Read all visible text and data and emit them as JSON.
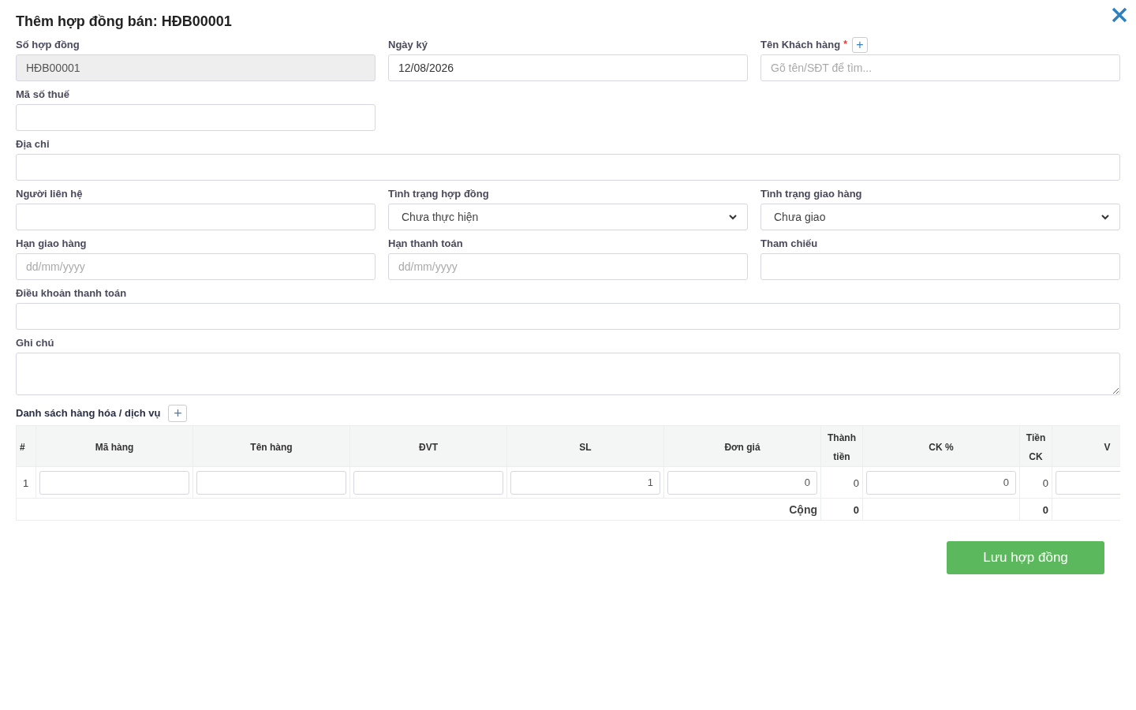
{
  "dialog": {
    "title": "Thêm hợp đồng bán: HĐB00001"
  },
  "fields": [
    {
      "label": "Số hợp đồng",
      "kind": "text",
      "value": "HĐB00001",
      "disabled": true
    },
    {
      "label": "Ngày ký",
      "kind": "text",
      "value": "12/08/2026"
    },
    {
      "label": "Tên Khách hàng",
      "kind": "text",
      "placeholder": "Gõ tên/SĐT để tìm...",
      "required_mark": "*",
      "add_button": "+"
    },
    {
      "label": "Mã số thuế",
      "kind": "text"
    },
    {
      "label": "Địa chỉ",
      "kind": "text",
      "full": true
    },
    {
      "label": "Người liên hệ",
      "kind": "text"
    },
    {
      "label": "Tình trạng hợp đồng",
      "kind": "select",
      "value": "Chưa thực hiện"
    },
    {
      "label": "Tình trạng giao hàng",
      "kind": "select",
      "value": "Chưa giao"
    },
    {
      "label": "Hạn giao hàng",
      "kind": "text",
      "placeholder": "dd/mm/yyyy"
    },
    {
      "label": "Hạn thanh toán",
      "kind": "text",
      "placeholder": "dd/mm/yyyy"
    },
    {
      "label": "Tham chiếu",
      "kind": "text"
    },
    {
      "label": "Điều khoản thanh toán",
      "kind": "text",
      "full": true
    },
    {
      "label": "Ghi chú",
      "kind": "textarea",
      "full": true
    }
  ],
  "items": {
    "title": "Danh sách hàng hóa / dịch vụ",
    "add_button": "+",
    "columns": [
      "#",
      "Mã hàng",
      "Tên hàng",
      "ĐVT",
      "SL",
      "Đơn giá",
      "Thành tiền",
      "CK %",
      "Tiền CK",
      "V"
    ],
    "rows": [
      {
        "cells": [
          {
            "kind": "text",
            "value": "1"
          },
          {
            "kind": "input"
          },
          {
            "kind": "input"
          },
          {
            "kind": "input"
          },
          {
            "kind": "input",
            "value": "1"
          },
          {
            "kind": "input",
            "value": "0"
          },
          {
            "kind": "text",
            "value": "0"
          },
          {
            "kind": "input",
            "value": "0"
          },
          {
            "kind": "text",
            "value": "0"
          },
          {
            "kind": "input"
          }
        ]
      }
    ],
    "footer": {
      "label": "Cộng",
      "total": "0",
      "discount_total": "0"
    }
  },
  "save_button": "Lưu hợp đồng"
}
